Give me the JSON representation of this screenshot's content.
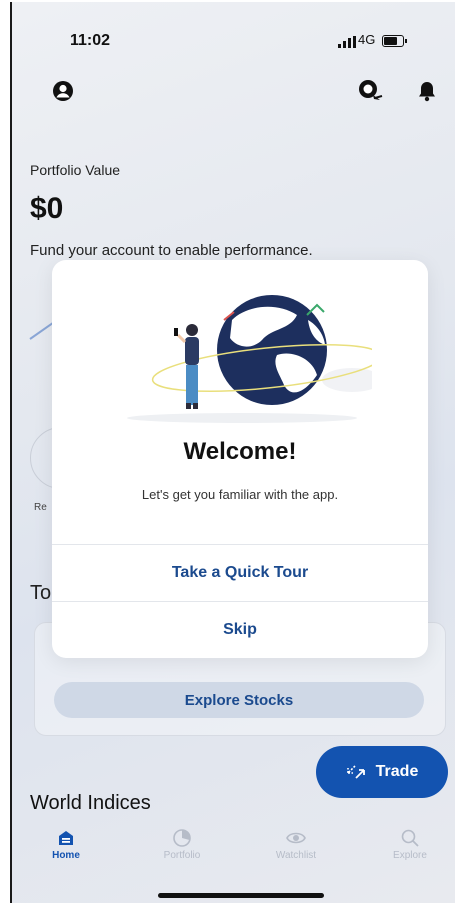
{
  "status_bar": {
    "time": "11:02",
    "network": "4G"
  },
  "header": {
    "icons": [
      "profile-icon",
      "chat-icon",
      "bell-icon"
    ]
  },
  "portfolio": {
    "label": "Portfolio Value",
    "value": "$0",
    "message": "Fund your account to enable performance."
  },
  "background": {
    "partial_label": "Re",
    "partial_section_title": "To",
    "explore_button": "Explore Stocks",
    "trade_button": "Trade",
    "world_indices_title": "World Indices"
  },
  "modal": {
    "title": "Welcome!",
    "subtitle": "Let's get you familiar with the app.",
    "tour_button": "Take a Quick Tour",
    "skip_button": "Skip"
  },
  "tabs": [
    {
      "label": "Home",
      "icon": "home-icon",
      "active": true
    },
    {
      "label": "Portfolio",
      "icon": "portfolio-icon",
      "active": false
    },
    {
      "label": "Watchlist",
      "icon": "eye-icon",
      "active": false
    },
    {
      "label": "Explore",
      "icon": "search-icon",
      "active": false
    }
  ],
  "colors": {
    "accent": "#1353b0",
    "link": "#1b4a8e",
    "inactive_tab": "#b6bcc8"
  }
}
